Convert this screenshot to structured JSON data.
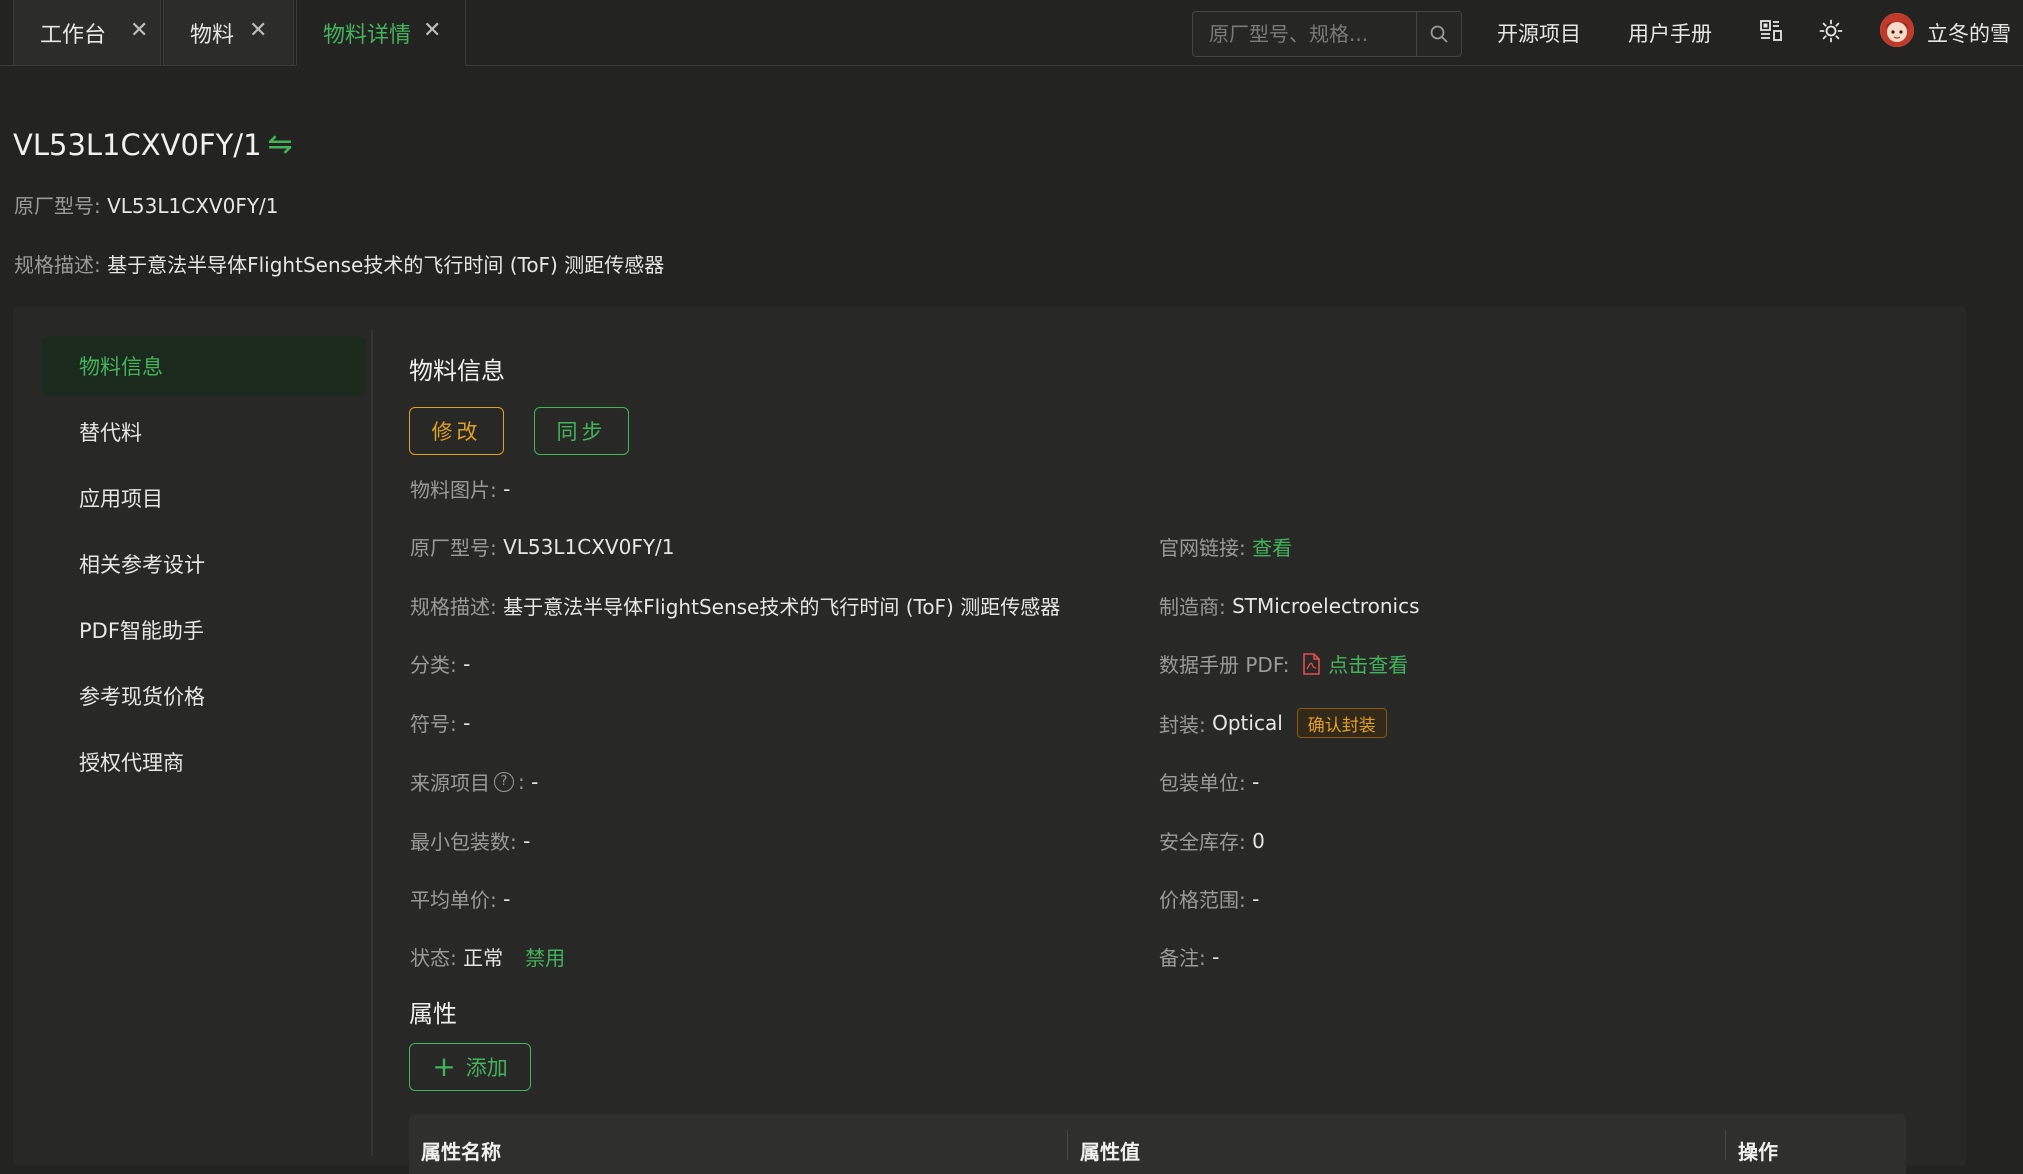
{
  "tabs": [
    {
      "label": "工作台",
      "close": "✕"
    },
    {
      "label": "物料",
      "close": "✕"
    },
    {
      "label": "物料详情",
      "close": "✕"
    }
  ],
  "header": {
    "search_placeholder": "原厂型号、规格...",
    "links": [
      "开源项目",
      "用户手册"
    ],
    "user_name": "立冬的雪"
  },
  "material": {
    "title": "VL53L1CXV0FY/1",
    "part_label": "原厂型号:",
    "part_value": "VL53L1CXV0FY/1",
    "spec_label": "规格描述:",
    "spec_value": "基于意法半导体FlightSense技术的飞行时间 (ToF) 测距传感器"
  },
  "menu": [
    "物料信息",
    "替代料",
    "应用项目",
    "相关参考设计",
    "PDF智能助手",
    "参考现货价格",
    "授权代理商"
  ],
  "info": {
    "section_title": "物料信息",
    "edit_label": "修改",
    "sync_label": "同步",
    "image": {
      "k": "物料图片:",
      "v": "-"
    },
    "part": {
      "k": "原厂型号:",
      "v": "VL53L1CXV0FY/1"
    },
    "website": {
      "k": "官网链接:",
      "v": "查看"
    },
    "spec": {
      "k": "规格描述:",
      "v": "基于意法半导体FlightSense技术的飞行时间 (ToF) 测距传感器"
    },
    "manufacturer": {
      "k": "制造商:",
      "v": "STMicroelectronics"
    },
    "category": {
      "k": "分类:",
      "v": "-"
    },
    "datasheet": {
      "k": "数据手册 PDF:",
      "v": "点击查看"
    },
    "symbol": {
      "k": "符号:",
      "v": "-"
    },
    "package": {
      "k": "封装:",
      "v": "Optical",
      "tag": "确认封装"
    },
    "source_project": {
      "k": "来源项目",
      "help": "?",
      "sep": ":",
      "v": "-"
    },
    "pack_unit": {
      "k": "包装单位:",
      "v": "-"
    },
    "min_pack": {
      "k": "最小包装数:",
      "v": "-"
    },
    "safety_stock": {
      "k": "安全库存:",
      "v": "0"
    },
    "avg_price": {
      "k": "平均单价:",
      "v": "-"
    },
    "price_range": {
      "k": "价格范围:",
      "v": "-"
    },
    "status": {
      "k": "状态:",
      "v": "正常",
      "action": "禁用"
    },
    "remark": {
      "k": "备注:",
      "v": "-"
    }
  },
  "attributes": {
    "section_title": "属性",
    "add_label": "添加",
    "columns": [
      "属性名称",
      "属性值",
      "操作"
    ]
  },
  "colors": {
    "accent": "#43b35c",
    "warning": "#e0a020",
    "background": "#232321",
    "card": "#282826",
    "danger": "#e05050"
  }
}
